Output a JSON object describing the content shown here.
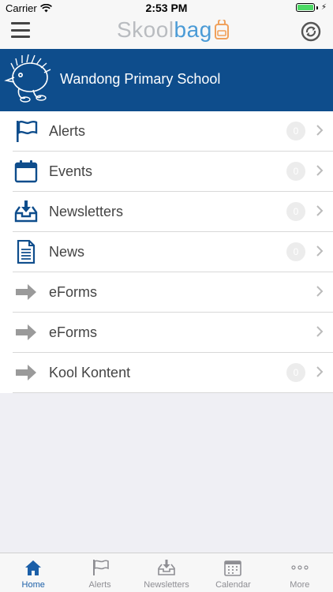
{
  "status_bar": {
    "carrier": "Carrier",
    "time": "2:53 PM"
  },
  "header": {
    "logo_part1": "Skool",
    "logo_part2": "bag"
  },
  "school": {
    "name": "Wandong Primary School"
  },
  "menu": [
    {
      "label": "Alerts",
      "icon": "flag-icon",
      "badge": "0"
    },
    {
      "label": "Events",
      "icon": "calendar-icon",
      "badge": "0"
    },
    {
      "label": "Newsletters",
      "icon": "inbox-download-icon",
      "badge": "0"
    },
    {
      "label": "News",
      "icon": "document-icon",
      "badge": "0"
    },
    {
      "label": "eForms",
      "icon": "arrow-right-icon",
      "badge": ""
    },
    {
      "label": "eForms",
      "icon": "arrow-right-icon",
      "badge": ""
    },
    {
      "label": "Kool Kontent",
      "icon": "arrow-right-icon",
      "badge": "0"
    }
  ],
  "tabs": [
    {
      "label": "Home",
      "icon": "home-icon",
      "active": true
    },
    {
      "label": "Alerts",
      "icon": "flag-icon",
      "active": false
    },
    {
      "label": "Newsletters",
      "icon": "inbox-download-icon",
      "active": false
    },
    {
      "label": "Calendar",
      "icon": "calendar-icon",
      "active": false
    },
    {
      "label": "More",
      "icon": "more-dots-icon",
      "active": false
    }
  ],
  "colors": {
    "brand_blue": "#0e4d8c",
    "active_tab": "#1b5fa8",
    "logo_grey": "#b9bcc0",
    "logo_blue": "#4b9bd6",
    "battery_green": "#4cd964"
  }
}
